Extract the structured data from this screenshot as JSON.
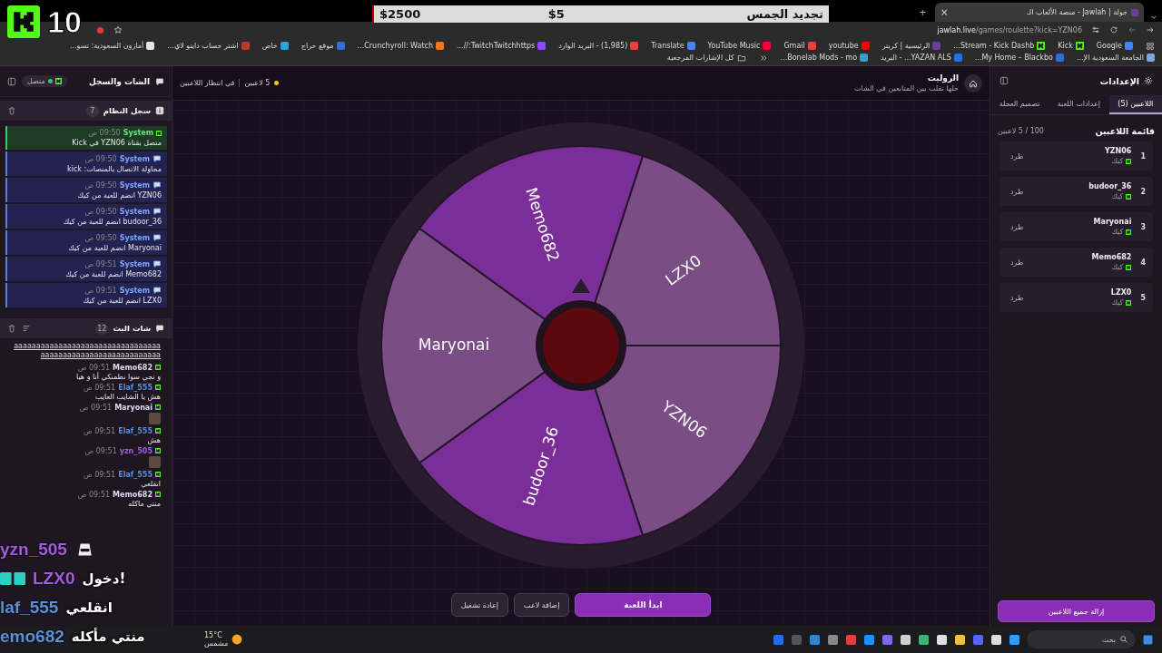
{
  "overlay": {
    "counter": "10",
    "bar": {
      "title": "تجديد الجمس",
      "price": "$5",
      "goal": "$2500"
    }
  },
  "browser": {
    "tab": {
      "title": "جولة | Jawlah - منصة الألعاب الـ",
      "close": "×"
    },
    "new_tab": "+",
    "url": {
      "host": "jawlah.live",
      "path": "/games/roulette?kick=YZN06"
    },
    "bookmarks": [
      {
        "label": "Google",
        "kind": "site",
        "color": "#4285f4"
      },
      {
        "label": "Kick",
        "kind": "kick"
      },
      {
        "label": "Stream - Kick Dashb...",
        "kind": "kick"
      },
      {
        "label": "الرئيسية | كريتر",
        "kind": "site",
        "color": "#6b3fa0"
      },
      {
        "label": "youtube",
        "kind": "site",
        "color": "#ff0000"
      },
      {
        "label": "Gmail",
        "kind": "site",
        "color": "#ea4335"
      },
      {
        "label": "YouTube Music",
        "kind": "site",
        "color": "#ff0033"
      },
      {
        "label": "Translate",
        "kind": "site",
        "color": "#4285f4"
      },
      {
        "label": "(1,985) - البريد الوارد",
        "kind": "site",
        "color": "#ea4335"
      },
      {
        "label": "TwitchTwitchhttps://...",
        "kind": "site",
        "color": "#9146ff"
      },
      {
        "label": "Crunchyroll: Watch...",
        "kind": "site",
        "color": "#f47521"
      },
      {
        "label": "موقع حراج",
        "kind": "site",
        "color": "#2f6fd6"
      },
      {
        "label": "خاص",
        "kind": "site",
        "color": "#2aa3df"
      },
      {
        "label": "اشتر حساب دايتو لاي...",
        "kind": "site",
        "color": "#c0392b"
      },
      {
        "label": "أمازون السعودية: تسو...",
        "kind": "site",
        "color": "#e6e6e6"
      },
      {
        "label": "الجامعة السعودية الإ...",
        "kind": "site",
        "color": "#7aa7d8"
      },
      {
        "label": "My Home – Blackbo...",
        "kind": "site",
        "color": "#2d6cdf"
      },
      {
        "label": "YAZAN ALS... - البريد",
        "kind": "site",
        "color": "#1a73e8"
      },
      {
        "label": "Bonelab Mods - mo...",
        "kind": "site",
        "color": "#3aa0c8"
      },
      {
        "label": "كل الإشارات المرجعية",
        "kind": "folder"
      }
    ]
  },
  "left_panel": {
    "title": "الشات والسجل",
    "connection": {
      "label": "متصل",
      "connected": true
    },
    "system_log": {
      "title": "سجل النظام",
      "count": "7",
      "entries": [
        {
          "kind": "kick",
          "sender": "System",
          "time": "09:50 ص",
          "message": "متصل بقناة YZN06 في Kick"
        },
        {
          "kind": "system",
          "sender": "System",
          "time": "09:50 ص",
          "message": "محاولة الاتصال بالمنصات: kick"
        },
        {
          "kind": "system",
          "sender": "System",
          "time": "09:50 ص",
          "message": "YZN06 انضم للعبة من كيك"
        },
        {
          "kind": "system",
          "sender": "System",
          "time": "09:50 ص",
          "message": "budoor_36 انضم للعبة من كيك"
        },
        {
          "kind": "system",
          "sender": "System",
          "time": "09:50 ص",
          "message": "Maryonai انضم للعبة من كيك"
        },
        {
          "kind": "system",
          "sender": "System",
          "time": "09:51 ص",
          "message": "Memo682 انضم للعبة من كيك"
        },
        {
          "kind": "system",
          "sender": "System",
          "time": "09:51 ص",
          "message": "LZX0 انضم للعبة من كيك"
        }
      ]
    },
    "stream_chat": {
      "title": "شات البث",
      "count": "12",
      "messages": [
        {
          "kind": "text",
          "message": "aaaaaaaaaaaaaaaaaaaaaaaaaaaaaaaaaaaaaaaaaaaaaaaaaaaaaaaaaaaa"
        },
        {
          "kind": "text",
          "user": "Memo682",
          "color": "#dcdcf0",
          "time": "09:51 ص",
          "message": "و نجي سوا نطمنكي أنا و هيا"
        },
        {
          "kind": "text",
          "user": "Elaf_555",
          "color": "#5b8fd6",
          "time": "09:51 ص",
          "message": "هش يا الشايب العايب"
        },
        {
          "kind": "emote",
          "user": "Maryonai",
          "color": "#dcdcf0",
          "time": "09:51 ص"
        },
        {
          "kind": "text",
          "user": "Elaf_555",
          "color": "#5b8fd6",
          "time": "09:51 ص",
          "message": "هش"
        },
        {
          "kind": "emote",
          "user": "yzn_505",
          "color": "#a45ae0",
          "time": "09:51 ص"
        },
        {
          "kind": "text",
          "user": "Elaf_555",
          "color": "#5b8fd6",
          "time": "09:51 ص",
          "message": "انقلعي"
        },
        {
          "kind": "text",
          "user": "Memo682",
          "color": "#dcdcf0",
          "time": "09:51 ص",
          "message": "منتي ماكله"
        }
      ]
    }
  },
  "center": {
    "title": "الروليت",
    "subtitle": "خلها تقلب بين المتابعين في الشات",
    "players_count": "5 لاعبين",
    "status": "في انتظار اللاعبين",
    "wheel": {
      "segments": [
        {
          "label": "LZX0",
          "color": "#7a4d84"
        },
        {
          "label": "YZN06",
          "color": "#7a4d84"
        },
        {
          "label": "budoor_36",
          "color": "#7b2d98"
        },
        {
          "label": "Maryonai",
          "color": "#7a4d84"
        },
        {
          "label": "Memo682",
          "color": "#7b2d98"
        }
      ]
    },
    "buttons": [
      {
        "label": "ابدأ اللعبة",
        "kind": "primary"
      },
      {
        "label": "إضافة لاعب",
        "kind": "secondary"
      },
      {
        "label": "إعادة تشغيل",
        "kind": "secondary"
      }
    ]
  },
  "right_panel": {
    "title": "الإعدادات",
    "tabs": [
      {
        "label": "اللاعبين (5)",
        "selected": true
      },
      {
        "label": "إعدادات اللعبة",
        "selected": false
      },
      {
        "label": "تصميم العجلة",
        "selected": false
      }
    ],
    "list_title": "قائمة اللاعبين",
    "list_count": "100 / 5 لاعبين",
    "players": [
      {
        "number": "1",
        "name": "YZN06",
        "platform": "كيك",
        "action": "طرد"
      },
      {
        "number": "2",
        "name": "budoor_36",
        "platform": "كيك",
        "action": "طرد"
      },
      {
        "number": "3",
        "name": "Maryonai",
        "platform": "كيك",
        "action": "طرد"
      },
      {
        "number": "4",
        "name": "Memo682",
        "platform": "كيك",
        "action": "طرد"
      },
      {
        "number": "5",
        "name": "LZX0",
        "platform": "كيك",
        "action": "طرد"
      }
    ],
    "remove_all": "إزالة جميع اللاعبين"
  },
  "stream_chat_overlay": [
    {
      "kind": "sticker",
      "user": "yzn_505",
      "color": "#a45ae0"
    },
    {
      "kind": "text",
      "user": "LZX0",
      "color": "#a45ae0",
      "message": "دخول!",
      "badges": true
    },
    {
      "kind": "text",
      "user": "laf_555",
      "color": "#5b8fd6",
      "message": "انقلعي"
    },
    {
      "kind": "text",
      "user": "emo682",
      "color": "#5b8fd6",
      "message": "منتي مأكله"
    }
  ],
  "taskbar": {
    "weather": {
      "temp": "15°C",
      "condition": "مشمس"
    },
    "search": "بحث"
  }
}
